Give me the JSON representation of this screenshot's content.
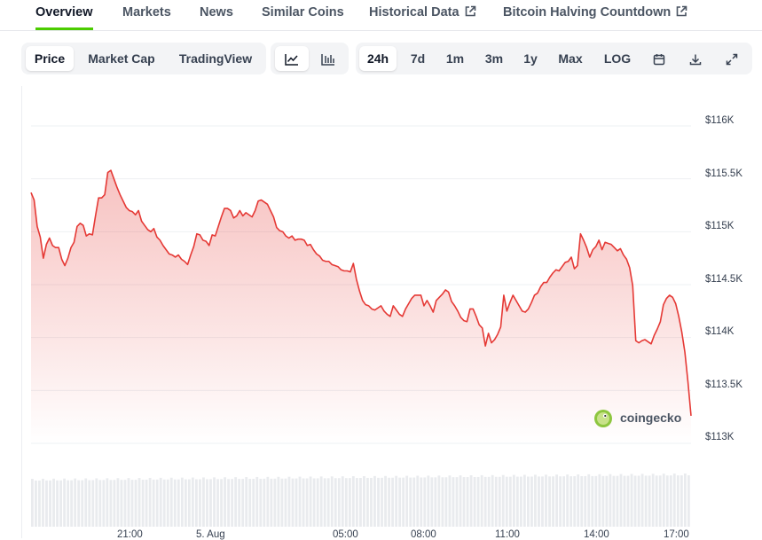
{
  "tabs": {
    "overview": "Overview",
    "markets": "Markets",
    "news": "News",
    "similar": "Similar Coins",
    "historical": "Historical Data",
    "halving": "Bitcoin Halving Countdown"
  },
  "toolbar": {
    "views": [
      "Price",
      "Market Cap",
      "TradingView"
    ],
    "active_view": "Price",
    "chart_type_icons": [
      "line-chart-icon",
      "candlestick-chart-icon"
    ],
    "ranges": [
      "24h",
      "7d",
      "1m",
      "3m",
      "1y",
      "Max",
      "LOG"
    ],
    "active_range": "24h",
    "action_icons": [
      "calendar-icon",
      "download-icon",
      "fullscreen-icon"
    ]
  },
  "watermark": "coingecko",
  "colors": {
    "accent": "#4bcc00",
    "price_line": "#e53935"
  },
  "chart_data": {
    "type": "area",
    "y_axis_labels": [
      "$116K",
      "$115.5K",
      "$115K",
      "$114.5K",
      "$114K",
      "$113.5K",
      "$113K"
    ],
    "ylim": [
      113000,
      116000
    ],
    "x_axis_labels": [
      "21:00",
      "5. Aug",
      "05:00",
      "08:00",
      "11:00",
      "14:00",
      "17:00"
    ],
    "grid": true,
    "legend": "none",
    "series": [
      {
        "values": [
          115370,
          115300,
          115050,
          114950,
          114750,
          114880,
          114940,
          114870,
          114850,
          114850,
          114740,
          114680,
          114750,
          114850,
          114900,
          115050,
          115080,
          115060,
          114960,
          114980,
          114970,
          115150,
          115320,
          115320,
          115350,
          115560,
          115580,
          115500,
          115420,
          115350,
          115290,
          115230,
          115200,
          115190,
          115160,
          115200,
          115100,
          115060,
          115020,
          115000,
          115030,
          114950,
          114920,
          114870,
          114830,
          114790,
          114780,
          114760,
          114780,
          114740,
          114720,
          114690,
          114780,
          114860,
          114980,
          114970,
          114920,
          114910,
          114870,
          114970,
          114960,
          115050,
          115140,
          115220,
          115220,
          115200,
          115130,
          115150,
          115200,
          115150,
          115180,
          115160,
          115140,
          115200,
          115290,
          115300,
          115280,
          115260,
          115200,
          115140,
          115040,
          115010,
          115000,
          114960,
          114940,
          114960,
          114920,
          114930,
          114930,
          114920,
          114870,
          114880,
          114830,
          114790,
          114770,
          114730,
          114720,
          114720,
          114690,
          114680,
          114670,
          114640,
          114630,
          114630,
          114620,
          114700,
          114550,
          114440,
          114350,
          114310,
          114300,
          114270,
          114260,
          114280,
          114300,
          114250,
          114220,
          114200,
          114300,
          114260,
          114220,
          114200,
          114270,
          114320,
          114370,
          114400,
          114400,
          114400,
          114300,
          114350,
          114300,
          114240,
          114350,
          114380,
          114410,
          114450,
          114430,
          114340,
          114300,
          114250,
          114190,
          114160,
          114150,
          114270,
          114270,
          114200,
          114120,
          114090,
          113920,
          114040,
          113950,
          113980,
          114030,
          114100,
          114400,
          114250,
          114330,
          114400,
          114350,
          114300,
          114250,
          114240,
          114270,
          114330,
          114400,
          114420,
          114480,
          114520,
          114520,
          114570,
          114610,
          114640,
          114630,
          114670,
          114710,
          114720,
          114760,
          114650,
          114680,
          114980,
          114920,
          114850,
          114760,
          114830,
          114860,
          114920,
          114830,
          114900,
          114890,
          114880,
          114850,
          114820,
          114840,
          114780,
          114740,
          114660,
          114490,
          113970,
          113950,
          113970,
          113980,
          113960,
          113940,
          114020,
          114080,
          114150,
          114310,
          114370,
          114400,
          114380,
          114320,
          114200,
          114050,
          113860,
          113580,
          113260
        ]
      }
    ]
  }
}
